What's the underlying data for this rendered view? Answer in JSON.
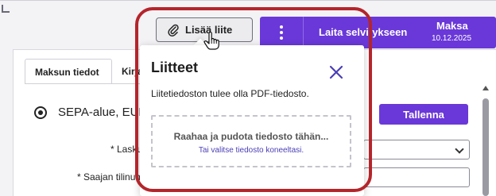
{
  "toolbar": {
    "attach_label": "Lisää liite",
    "send_label": "Laita selvitykseen",
    "pay_label": "Maksa",
    "pay_date": "10.12.2025"
  },
  "tabs": [
    {
      "label": "Maksun tiedot",
      "active": true
    },
    {
      "label": "Kirjanpito",
      "active": false
    }
  ],
  "form": {
    "radio_label": "SEPA-alue, EUR",
    "save_label": "Tallenna",
    "field1_label": "* Laskuviite",
    "field2_label": "* Saajan tilinumero"
  },
  "popover": {
    "title": "Liitteet",
    "description": "Liitetiedoston tulee olla PDF-tiedosto.",
    "drop_text": "Raahaa ja pudota tiedosto tähän...",
    "browse_link": "Tai valitse tiedosto koneeltasi."
  },
  "icons": {
    "attach": "paperclip-icon",
    "cursor": "hand-pointer-icon",
    "more": "more-vertical-icon",
    "close": "close-icon",
    "dropdown": "chevron-down-icon"
  },
  "colors": {
    "accent": "#6a38d8",
    "highlight": "#b4252b",
    "link": "#4a3fb5"
  }
}
